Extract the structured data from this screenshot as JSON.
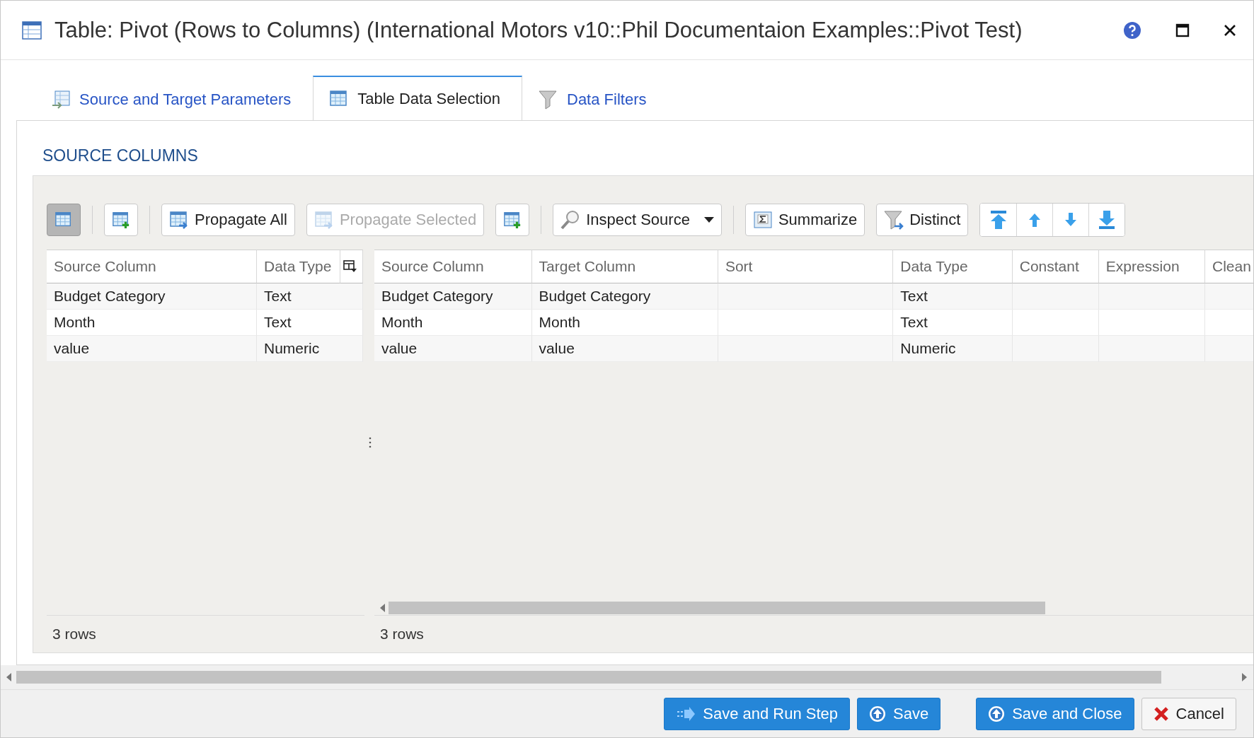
{
  "window": {
    "title": "Table: Pivot (Rows to Columns) (International Motors v10::Phil Documentaion Examples::Pivot Test)"
  },
  "tabs": [
    {
      "label": "Source and Target Parameters",
      "selected": false,
      "kind": "params"
    },
    {
      "label": "Table Data Selection",
      "selected": true,
      "kind": "grid"
    },
    {
      "label": "Data Filters",
      "selected": false,
      "kind": "filter"
    }
  ],
  "section_title": "SOURCE COLUMNS",
  "toolbar": [
    {
      "kind": "toggle",
      "selected": true
    },
    {
      "kind": "separator"
    },
    {
      "kind": "add"
    },
    {
      "kind": "separator"
    },
    {
      "kind": "propagate",
      "label": "Propagate All",
      "disabled": false
    },
    {
      "kind": "propagate",
      "label": "Propagate Selected",
      "disabled": true
    },
    {
      "kind": "add"
    },
    {
      "kind": "separator"
    },
    {
      "kind": "dropdown",
      "label": "Inspect Source"
    },
    {
      "kind": "separator"
    },
    {
      "kind": "summarize",
      "label": "Summarize"
    },
    {
      "kind": "distinct",
      "label": "Distinct"
    },
    {
      "kind": "moves"
    }
  ],
  "source_table": {
    "columns": [
      "Source Column",
      "Data Type"
    ],
    "rows": [
      [
        "Budget Category",
        "Text"
      ],
      [
        "Month",
        "Text"
      ],
      [
        "value",
        "Numeric"
      ]
    ],
    "footer": "3 rows"
  },
  "target_table": {
    "columns": [
      "Source Column",
      "Target Column",
      "Sort",
      "Data Type",
      "Constant",
      "Expression",
      "Clean"
    ],
    "rows": [
      [
        "Budget Category",
        "Budget Category",
        "",
        "Text",
        "",
        "",
        ""
      ],
      [
        "Month",
        "Month",
        "",
        "Text",
        "",
        "",
        ""
      ],
      [
        "value",
        "value",
        "",
        "Numeric",
        "",
        "",
        ""
      ]
    ],
    "footer": "3 rows"
  },
  "buttons": [
    {
      "label": "Save and Run Step",
      "kind": "run"
    },
    {
      "label": "Save",
      "kind": "save"
    },
    {
      "label": "Save and Close",
      "kind": "save"
    },
    {
      "label": "Cancel",
      "kind": "cancel"
    }
  ]
}
